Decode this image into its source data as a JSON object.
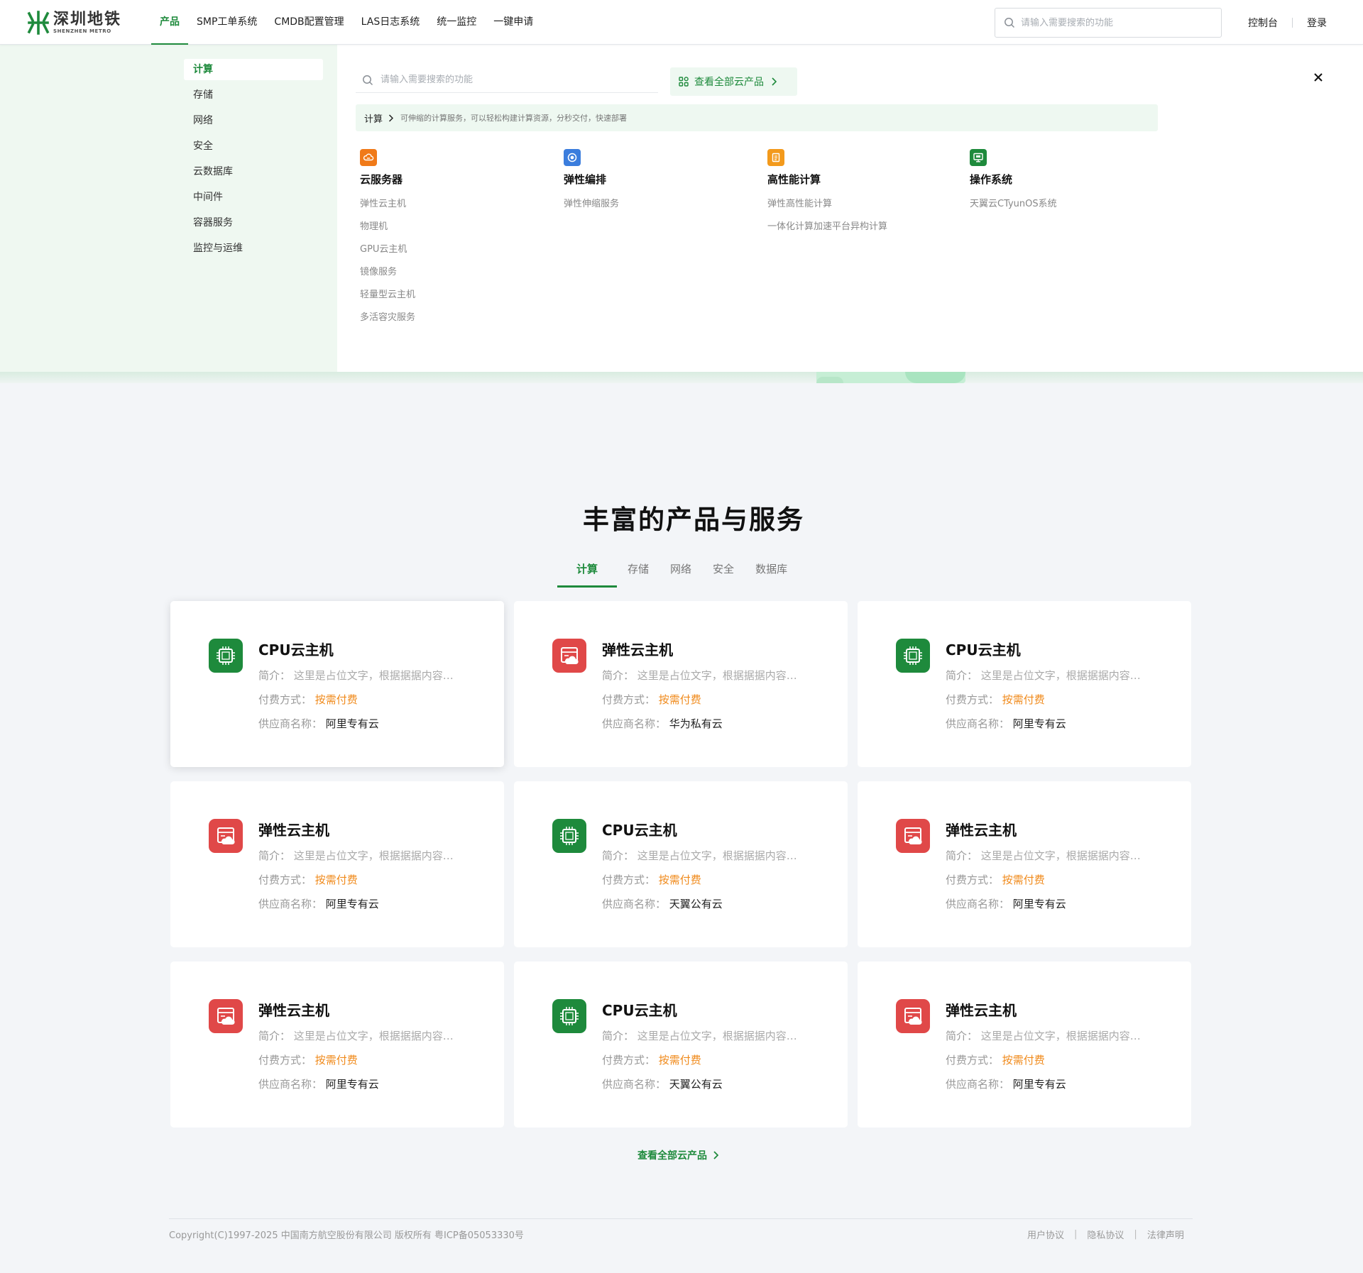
{
  "header": {
    "logo_cn": "深圳地铁",
    "logo_en": "SHENZHEN METRO",
    "nav": [
      "产品",
      "SMP工单系统",
      "CMDB配置管理",
      "LAS日志系统",
      "统一监控",
      "一键申请"
    ],
    "search_placeholder": "请输入需要搜索的功能",
    "console": "控制台",
    "login": "登录"
  },
  "mega_menu": {
    "categories": [
      "计算",
      "存储",
      "网络",
      "安全",
      "云数据库",
      "中间件",
      "容器服务",
      "监控与运维"
    ],
    "search_placeholder": "请输入需要搜索的功能",
    "view_all": "查看全部云产品",
    "crumb_title": "计算",
    "crumb_desc": "可伸缩的计算服务，可以轻松构建计算资源，分秒交付，快速部署",
    "groups": [
      {
        "title": "云服务器",
        "color": "#f07a19",
        "items": [
          "弹性云主机",
          "物理机",
          "GPU云主机",
          "镜像服务",
          "轻量型云主机",
          "多活容灾服务"
        ]
      },
      {
        "title": "弹性编排",
        "color": "#3b7ddd",
        "items": [
          "弹性伸缩服务"
        ]
      },
      {
        "title": "高性能计算",
        "color": "#f39a1c",
        "items": [
          "弹性高性能计算",
          "一体化计算加速平台异构计算"
        ]
      },
      {
        "title": "操作系统",
        "color": "#1e8a3c",
        "items": [
          "天翼云CTyunOS系统"
        ]
      }
    ]
  },
  "main": {
    "title": "丰富的产品与服务",
    "tabs": [
      "计算",
      "存储",
      "网络",
      "安全",
      "数据库"
    ],
    "labels": {
      "intro": "简介：",
      "pay": "付费方式：",
      "vendor": "供应商名称："
    },
    "cards": [
      {
        "type": "cpu",
        "title": "CPU云主机",
        "intro": "这里是占位文字，根据据据内容…",
        "pay": "按需付费",
        "vendor": "阿里专有云"
      },
      {
        "type": "elastic",
        "title": "弹性云主机",
        "intro": "这里是占位文字，根据据据内容…",
        "pay": "按需付费",
        "vendor": "华为私有云"
      },
      {
        "type": "cpu",
        "title": "CPU云主机",
        "intro": "这里是占位文字，根据据据内容…",
        "pay": "按需付费",
        "vendor": "阿里专有云"
      },
      {
        "type": "elastic",
        "title": "弹性云主机",
        "intro": "这里是占位文字，根据据据内容…",
        "pay": "按需付费",
        "vendor": "阿里专有云"
      },
      {
        "type": "cpu",
        "title": "CPU云主机",
        "intro": "这里是占位文字，根据据据内容…",
        "pay": "按需付费",
        "vendor": "天翼公有云"
      },
      {
        "type": "elastic",
        "title": "弹性云主机",
        "intro": "这里是占位文字，根据据据内容…",
        "pay": "按需付费",
        "vendor": "阿里专有云"
      },
      {
        "type": "elastic",
        "title": "弹性云主机",
        "intro": "这里是占位文字，根据据据内容…",
        "pay": "按需付费",
        "vendor": "阿里专有云"
      },
      {
        "type": "cpu",
        "title": "CPU云主机",
        "intro": "这里是占位文字，根据据据内容…",
        "pay": "按需付费",
        "vendor": "天翼公有云"
      },
      {
        "type": "elastic",
        "title": "弹性云主机",
        "intro": "这里是占位文字，根据据据内容…",
        "pay": "按需付费",
        "vendor": "阿里专有云"
      }
    ],
    "more": "查看全部云产品"
  },
  "footer": {
    "copyright": "Copyright(C)1997-2025 中国南方航空股份有限公司 版权所有 粤ICP备05053330号",
    "links": [
      "用户协议",
      "隐私协议",
      "法律声明"
    ]
  },
  "colors": {
    "brand": "#1e8a3c",
    "pay": "#f08a1b",
    "cpu_icon": "#1e8a3c",
    "elastic_icon": "#e04848"
  },
  "icons": {
    "search": "search-icon",
    "close": "close-icon",
    "grid": "grid-icon",
    "chevron": "chevron-right-icon"
  }
}
